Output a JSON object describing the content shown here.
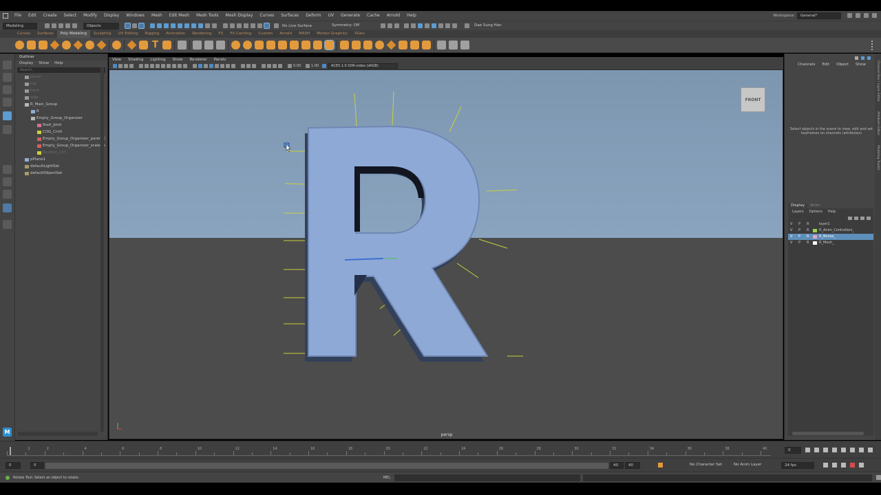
{
  "menubar": {
    "items": [
      "File",
      "Edit",
      "Create",
      "Select",
      "Modify",
      "Display",
      "Windows",
      "Mesh",
      "Edit Mesh",
      "Mesh Tools",
      "Mesh Display",
      "Curves",
      "Surfaces",
      "Deform",
      "UV",
      "Generate",
      "Cache",
      "Arnold",
      "Help"
    ],
    "workspace_label": "Workspace:",
    "workspace_value": "General*"
  },
  "statusline": {
    "mode": "Modeling",
    "select_mode": "Objects",
    "live_surface": "No Live Surface",
    "symmetry": "Symmetry: Off",
    "user": "Dae Sung Han"
  },
  "shelf": {
    "tabs": [
      "Curves",
      "Surfaces",
      "Poly Modeling",
      "Sculpting",
      "UV Editing",
      "Rigging",
      "Animation",
      "Rendering",
      "FX",
      "FX Caching",
      "Custom",
      "Arnold",
      "MASH",
      "Motion Graphics",
      "XGen"
    ],
    "active_tab": "Poly Modeling"
  },
  "outliner": {
    "title": "Outliner",
    "menu": [
      "Display",
      "Show",
      "Help"
    ],
    "search_placeholder": "Search...",
    "items": [
      {
        "label": "persp",
        "dim": true,
        "indent": 0,
        "icon": "camera"
      },
      {
        "label": "top",
        "dim": true,
        "indent": 0,
        "icon": "camera"
      },
      {
        "label": "front",
        "dim": true,
        "indent": 0,
        "icon": "camera"
      },
      {
        "label": "side",
        "dim": true,
        "indent": 0,
        "icon": "camera"
      },
      {
        "label": "R_Main_Group",
        "dim": false,
        "indent": 0,
        "icon": "group"
      },
      {
        "label": "R",
        "dim": false,
        "indent": 1,
        "icon": "mesh"
      },
      {
        "label": "Empty_Group_Organizer",
        "dim": false,
        "indent": 1,
        "icon": "group"
      },
      {
        "label": "Root_Joint",
        "dim": false,
        "indent": 2,
        "icon": "joint"
      },
      {
        "label": "COG_Cntrl",
        "dim": false,
        "indent": 2,
        "icon": "curve"
      },
      {
        "label": "Empty_Group_Organizer_parentC",
        "dim": false,
        "indent": 2,
        "icon": "constraint"
      },
      {
        "label": "Empty_Group_Organizer_scaleCo",
        "dim": false,
        "indent": 2,
        "icon": "constraint"
      },
      {
        "label": "Position_Ctrl",
        "dim": true,
        "indent": 2,
        "icon": "curve"
      },
      {
        "label": "pPlane1",
        "dim": false,
        "indent": 0,
        "icon": "mesh"
      },
      {
        "label": "defaultLightSet",
        "dim": false,
        "indent": 0,
        "icon": "set"
      },
      {
        "label": "defaultObjectSet",
        "dim": false,
        "indent": 0,
        "icon": "set"
      }
    ]
  },
  "viewport": {
    "menu": [
      "View",
      "Shading",
      "Lighting",
      "Show",
      "Renderer",
      "Panels"
    ],
    "exposure": "0.00",
    "gamma": "1.00",
    "color_space": "ACES 1.0 SDR-video (sRGB)",
    "view_cube_label": "FRONT",
    "camera_name": "persp",
    "model_letter": "R"
  },
  "channelbox": {
    "menu": [
      "Channels",
      "Edit",
      "Object",
      "Show"
    ],
    "message": "Select objects in the scene to view, edit and set keyframes on channels (attributes)",
    "layer_tabs": [
      "Display",
      "Anim"
    ],
    "layer_menu": [
      "Layers",
      "Options",
      "Help"
    ],
    "layers": [
      {
        "v": "V",
        "p": "P",
        "r": "R",
        "name": "layer1",
        "color": "",
        "selected": false
      },
      {
        "v": "V",
        "p": "P",
        "r": "R",
        "name": "R_Anim_Controllers_",
        "color": "#9bd34a",
        "selected": false
      },
      {
        "v": "V",
        "p": "P",
        "r": "R",
        "name": "R_Bones_",
        "color": "#e7a4c3",
        "selected": true
      },
      {
        "v": "V",
        "p": "P",
        "r": "R",
        "name": "R_Mesh_",
        "color": "#ffffff",
        "selected": false
      }
    ],
    "side_tabs": [
      "Channel Box / Layer Editor",
      "Attribute Editor",
      "Modeling Toolkit"
    ]
  },
  "timeslider": {
    "ticks": [
      "1",
      "2",
      "4",
      "6",
      "8",
      "10",
      "12",
      "14",
      "16",
      "18",
      "20",
      "22",
      "24",
      "26",
      "28",
      "30",
      "32",
      "34",
      "36",
      "38",
      "40"
    ],
    "current_frame": "0"
  },
  "range": {
    "start": "0",
    "inner_start": "0",
    "inner_end": "40",
    "end": "40",
    "character_set": "No Character Set",
    "anim_layer": "No Anim Layer",
    "fps": "24 fps"
  },
  "cmdline": {
    "help": "Rotate Tool: Select an object to rotate.",
    "lang": "MEL"
  },
  "colors": {
    "accent_orange": "#e39a3c",
    "select_blue": "#5d9bd0",
    "model_blue": "#8fa9d6",
    "control_yellow": "#c9d13a"
  }
}
